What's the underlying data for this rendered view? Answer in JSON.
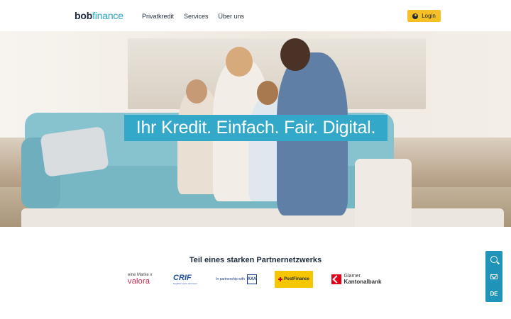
{
  "header": {
    "logo_part1": "bob",
    "logo_part2": "finance",
    "nav": [
      "Privatkredit",
      "Services",
      "Über uns"
    ],
    "login_label": "Login"
  },
  "hero": {
    "headline": "Ihr Kredit. Einfach. Fair. Digital."
  },
  "partners": {
    "title": "Teil eines starken Partnernetzwerks",
    "valora_small": "eine Marke v",
    "valora": "valora",
    "crif": "CRIF",
    "crif_tagline": "Together to the next level",
    "axa_text": "In partnership with",
    "axa_mark": "AXA",
    "postfinance": "PostFinance",
    "gkb_line1": "Glarner",
    "gkb_line2": "Kantonalbank"
  },
  "sidebar": {
    "search_icon": "search-icon",
    "mail_icon": "mail-icon",
    "language": "DE"
  },
  "colors": {
    "accent": "#33a8c8",
    "login": "#f6bf26",
    "sidebar": "#1f93b8"
  }
}
